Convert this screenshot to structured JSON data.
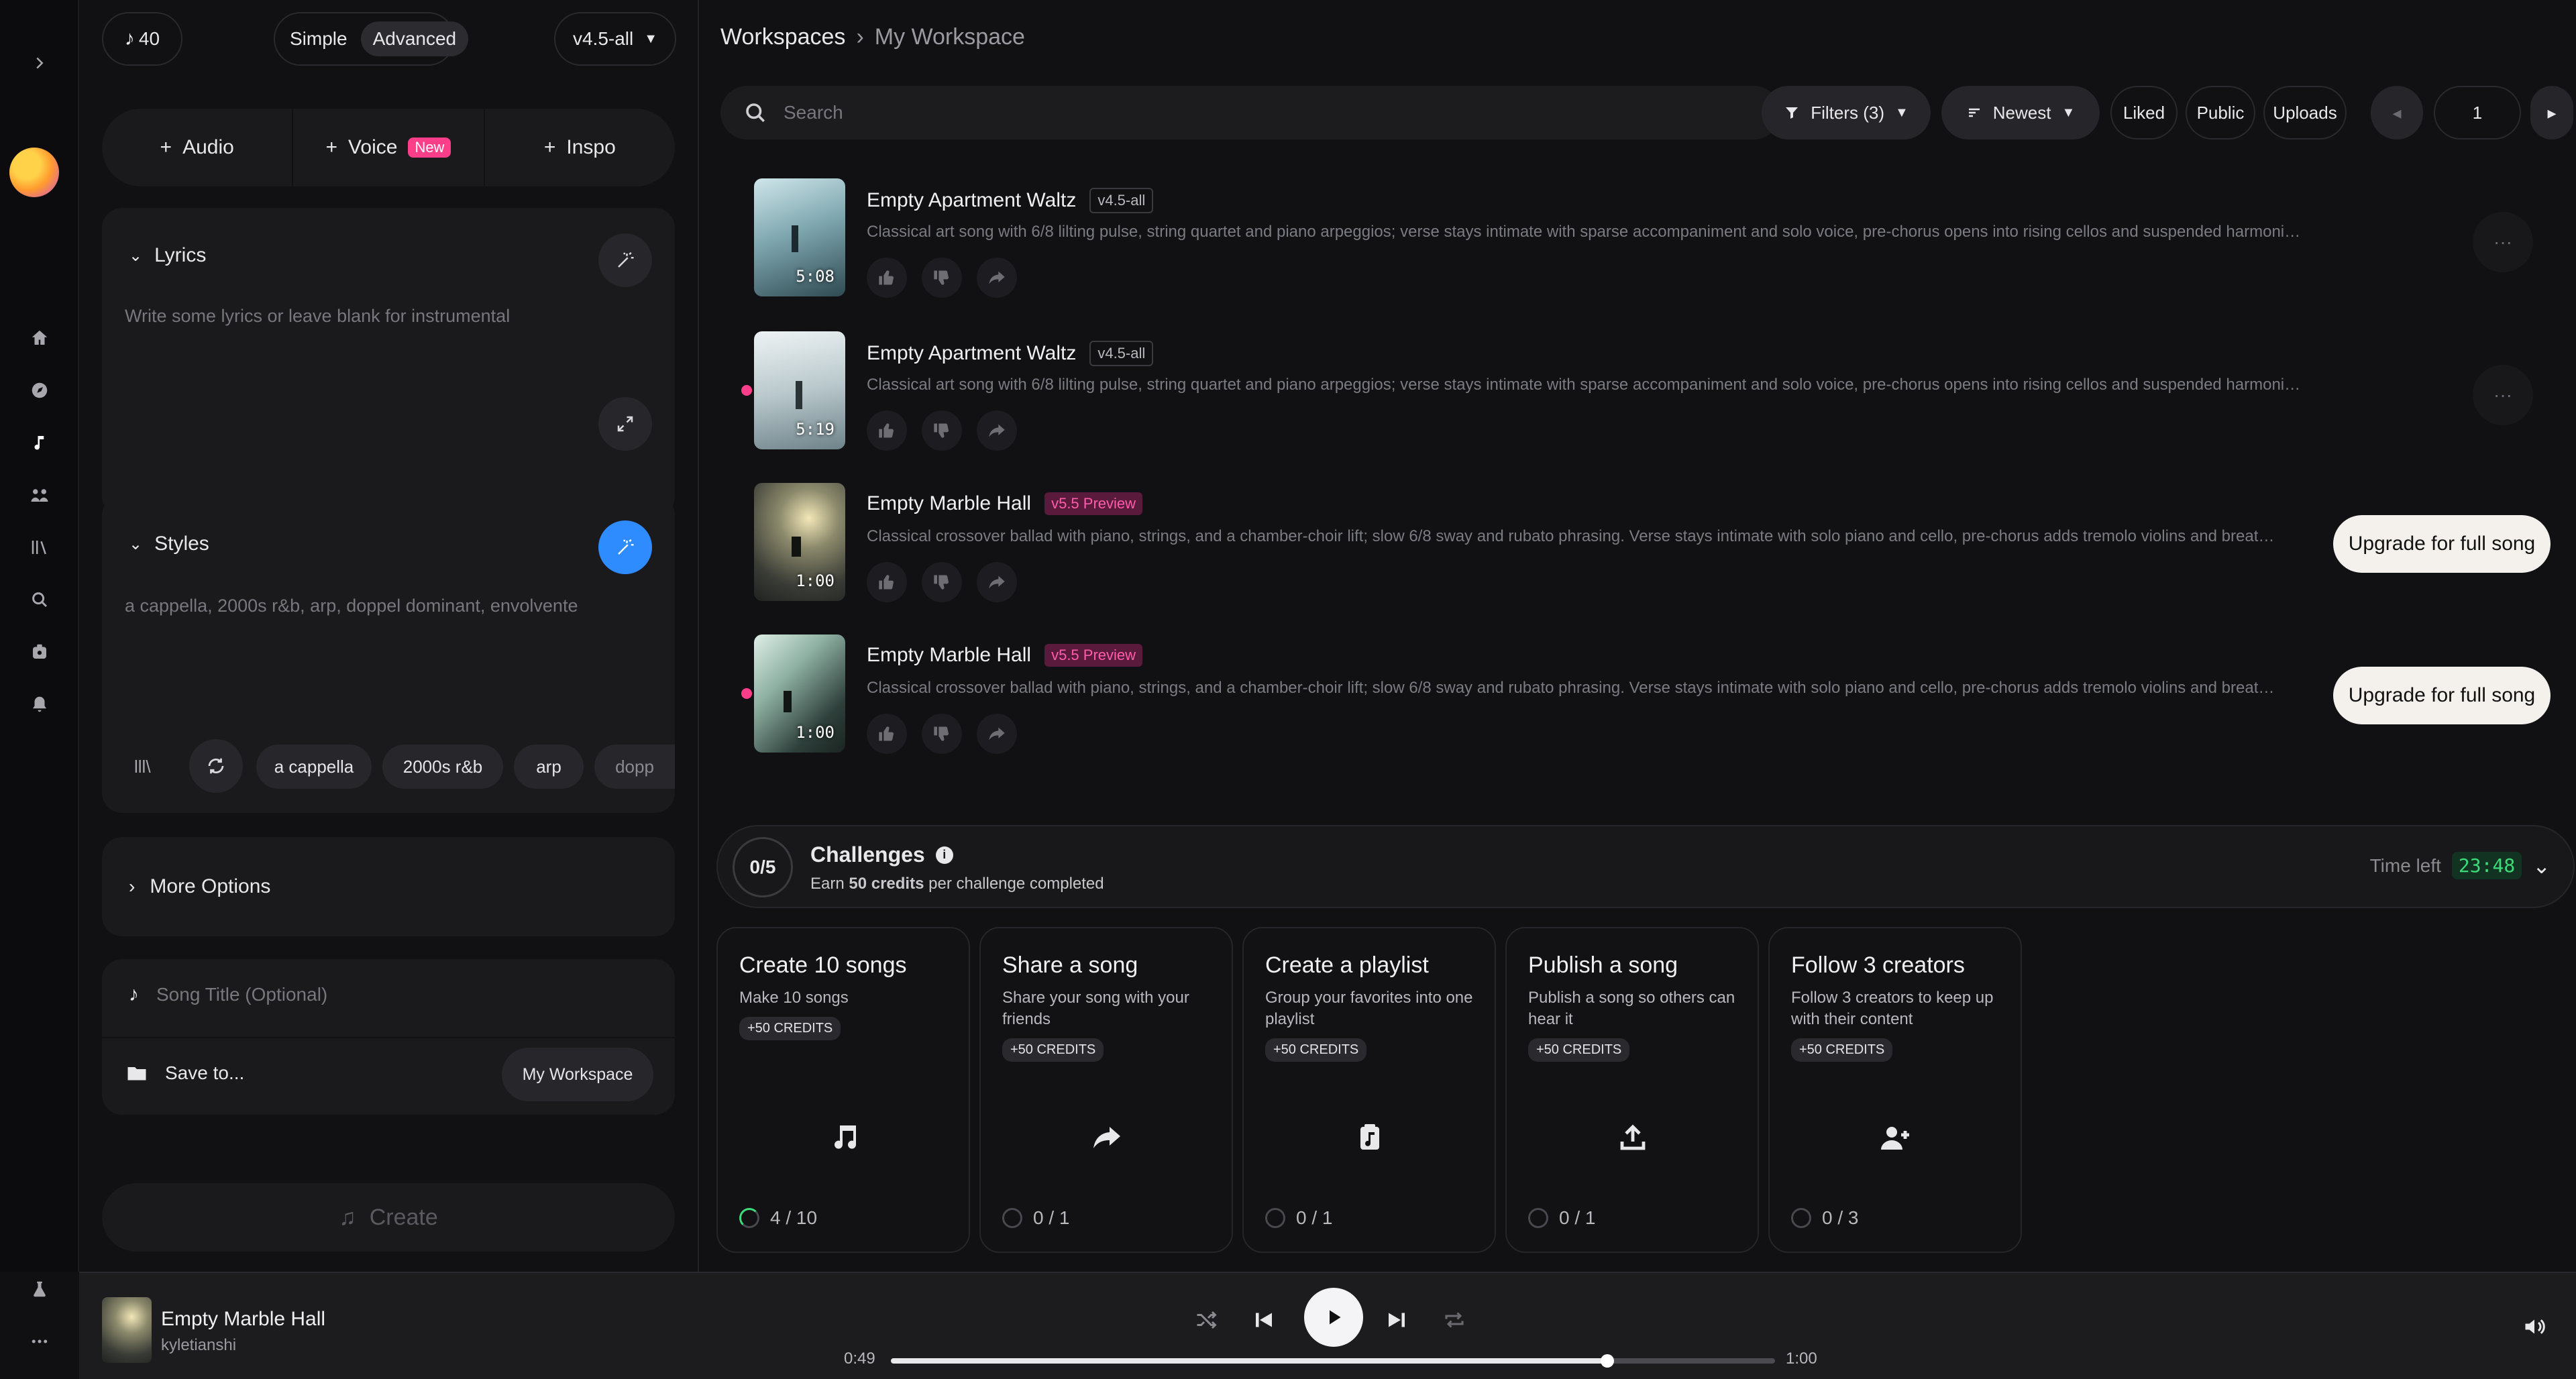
{
  "header": {
    "credits": "40",
    "mode_simple": "Simple",
    "mode_advanced": "Advanced",
    "version": "v4.5-all"
  },
  "create": {
    "add_audio": "Audio",
    "add_voice": "Voice",
    "voice_badge": "New",
    "add_inspo": "Inspo",
    "lyrics_label": "Lyrics",
    "lyrics_placeholder": "Write some lyrics or leave blank for instrumental",
    "styles_label": "Styles",
    "styles_placeholder": "a cappella, 2000s r&b, arp, doppel dominant, envolvente",
    "style_chips": [
      "a cappella",
      "2000s r&b",
      "arp",
      "dopp"
    ],
    "more_options": "More Options",
    "song_title_placeholder": "Song Title (Optional)",
    "save_to": "Save to...",
    "workspace_chip": "My Workspace",
    "create_button": "Create"
  },
  "main": {
    "breadcrumb_root": "Workspaces",
    "breadcrumb_current": "My Workspace",
    "search_placeholder": "Search",
    "filters": "Filters (3)",
    "sort": "Newest",
    "liked": "Liked",
    "public": "Public",
    "uploads": "Uploads",
    "page": "1"
  },
  "songs": [
    {
      "title": "Empty Apartment Waltz",
      "tag": "v4.5-all",
      "duration": "5:08",
      "desc": "Classical art song with 6/8 lilting pulse, string quartet and piano arpeggios; verse stays intimate with sparse accompaniment and solo voice, pre-chorus opens into rising cellos and suspended harmonie..."
    },
    {
      "title": "Empty Apartment Waltz",
      "tag": "v4.5-all",
      "duration": "5:19",
      "desc": "Classical art song with 6/8 lilting pulse, string quartet and piano arpeggios; verse stays intimate with sparse accompaniment and solo voice, pre-chorus opens into rising cellos and suspended harmonie..."
    },
    {
      "title": "Empty Marble Hall",
      "tag": "v5.5 Preview",
      "duration": "1:00",
      "desc": "Classical crossover ballad with piano, strings, and a chamber-choir lift; slow 6/8 sway and rubato phrasing. Verse stays intimate with solo piano and cello, pre-chorus adds tremolo violins and breathy doubled...",
      "upgrade": "Upgrade for full song"
    },
    {
      "title": "Empty Marble Hall",
      "tag": "v5.5 Preview",
      "duration": "1:00",
      "desc": "Classical crossover ballad with piano, strings, and a chamber-choir lift; slow 6/8 sway and rubato phrasing. Verse stays intimate with solo piano and cello, pre-chorus adds tremolo violins and breathy doubled...",
      "upgrade": "Upgrade for full song"
    }
  ],
  "challenges": {
    "progress": "0/5",
    "title": "Challenges",
    "sub_prefix": "Earn ",
    "sub_bold": "50 credits",
    "sub_suffix": " per challenge completed",
    "time_left_label": "Time left",
    "time_left": "23:48",
    "cards": [
      {
        "title": "Create 10 songs",
        "sub": "Make 10 songs",
        "badge": "+50 CREDITS",
        "progress": "4 / 10",
        "icon": "music-note-icon"
      },
      {
        "title": "Share a song",
        "sub": "Share your song with your friends",
        "badge": "+50 CREDITS",
        "progress": "0 / 1",
        "icon": "share-icon"
      },
      {
        "title": "Create a playlist",
        "sub": "Group your favorites into one playlist",
        "badge": "+50 CREDITS",
        "progress": "0 / 1",
        "icon": "playlist-icon"
      },
      {
        "title": "Publish a song",
        "sub": "Publish a song so others can hear it",
        "badge": "+50 CREDITS",
        "progress": "0 / 1",
        "icon": "upload-icon"
      },
      {
        "title": "Follow 3 creators",
        "sub": "Follow 3 creators to keep up with their content",
        "badge": "+50 CREDITS",
        "progress": "0 / 3",
        "icon": "add-user-icon"
      }
    ]
  },
  "player": {
    "title": "Empty Marble Hall",
    "artist": "kyletianshi",
    "elapsed": "0:49",
    "total": "1:00",
    "progress_fraction": 0.81
  },
  "colors": {
    "accent_blue": "#2f8cff",
    "brand_pink": "#ff3e8a",
    "timer_green": "#3ddc7a"
  }
}
